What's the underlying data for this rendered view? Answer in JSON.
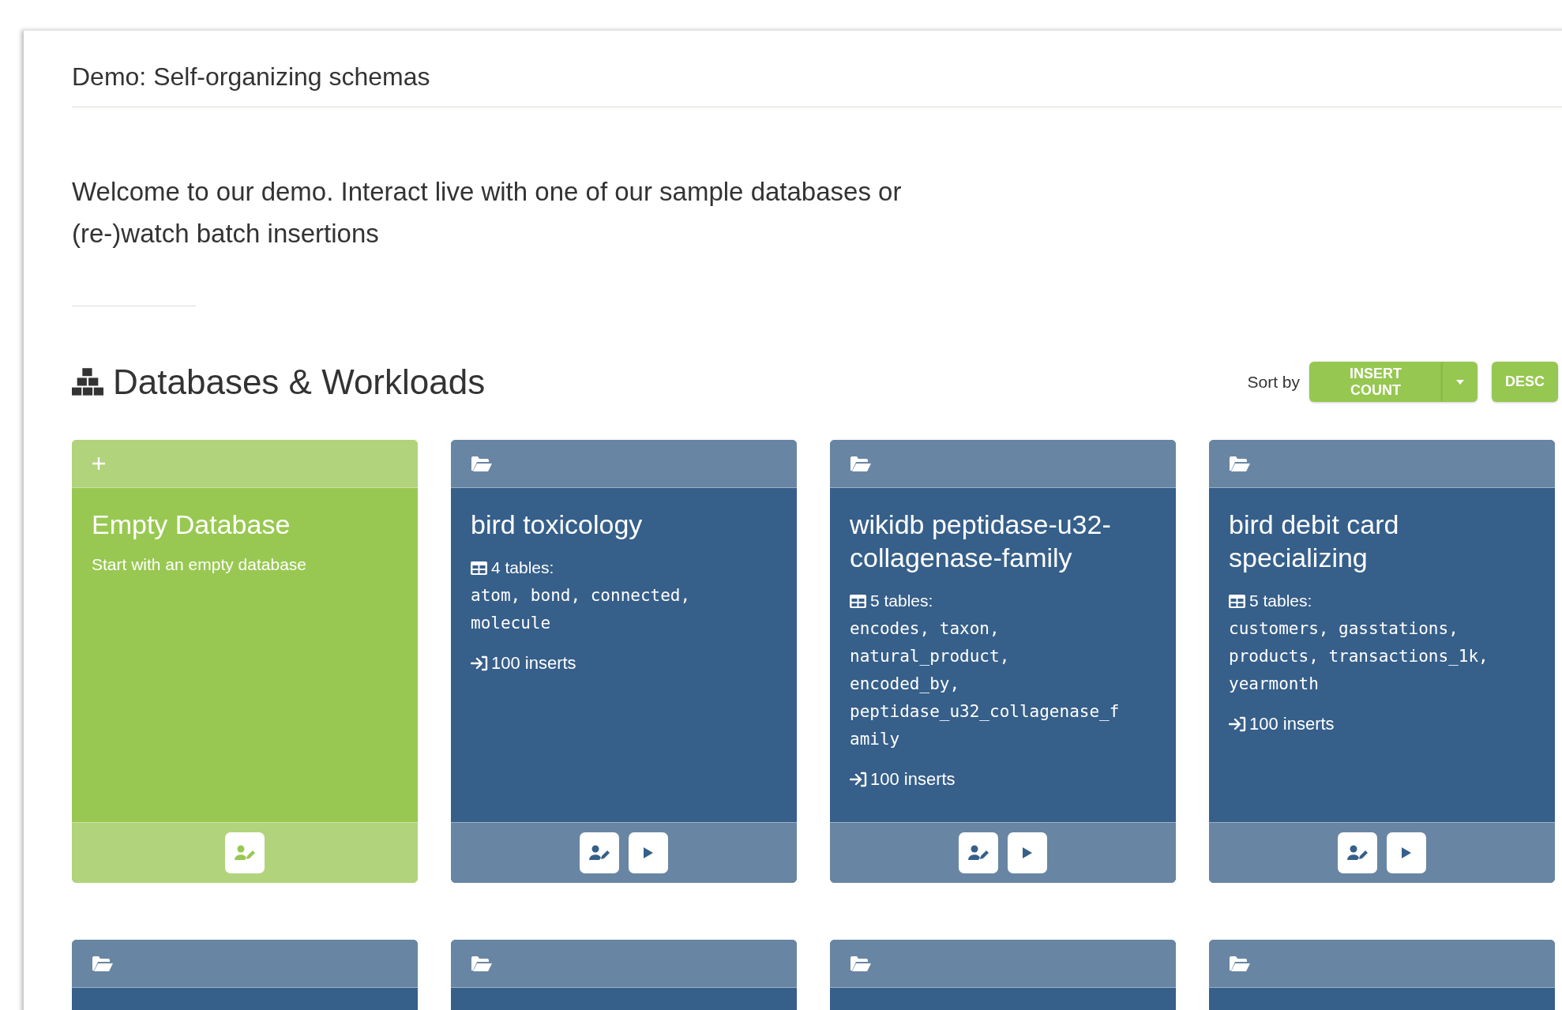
{
  "page_title": "Demo: Self-organizing schemas",
  "intro": "Welcome to our demo. Interact live with one of our sample databases or (re-)watch batch insertions",
  "section": {
    "heading": "Databases & Workloads",
    "sort_label": "Sort by",
    "sort_field": "INSERT COUNT",
    "sort_order": "DESC"
  },
  "cards": [
    {
      "kind": "create",
      "title": "Empty Database",
      "subtitle": "Start with an empty database"
    },
    {
      "kind": "database",
      "title": "bird toxicology",
      "tables_count": "4 tables:",
      "tables": "atom, bond, connected, molecule",
      "inserts": "100 inserts"
    },
    {
      "kind": "database",
      "title": "wikidb peptidase-u32-collagenase-family",
      "tables_count": "5 tables:",
      "tables": "encodes, taxon, natural_product, encoded_by, peptidase_u32_collagenase_family",
      "inserts": "100 inserts"
    },
    {
      "kind": "database",
      "title": "bird debit card specializing",
      "tables_count": "5 tables:",
      "tables": "customers, gasstations, products, transactions_1k, yearmonth",
      "inserts": "100 inserts"
    },
    {
      "kind": "database"
    },
    {
      "kind": "database"
    },
    {
      "kind": "database"
    },
    {
      "kind": "database"
    }
  ]
}
